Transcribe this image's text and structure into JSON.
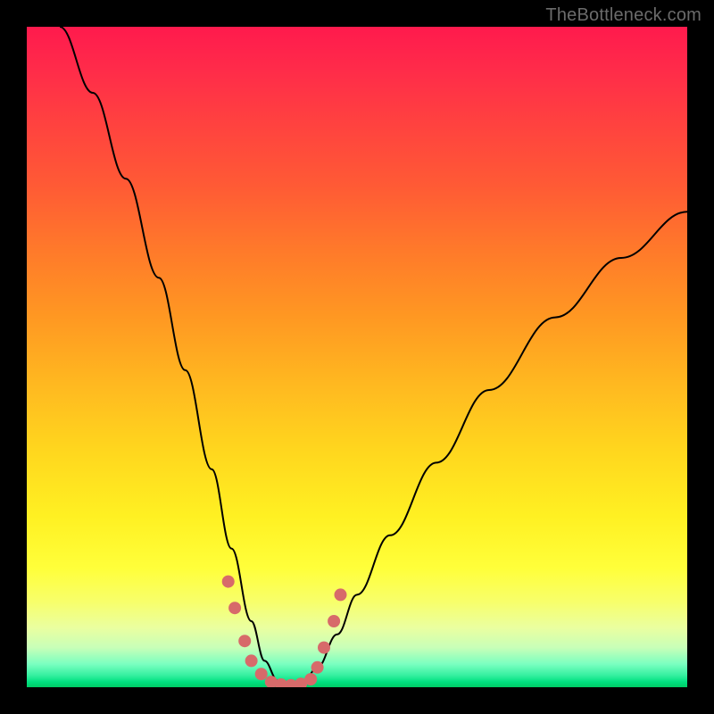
{
  "watermark": "TheBottleneck.com",
  "colors": {
    "page_bg": "#000000",
    "curve_stroke": "#000000",
    "marker_fill": "#d76a6a",
    "gradient_stops": [
      "#ff1a4d",
      "#ff2a4a",
      "#ff4040",
      "#ff5a35",
      "#ff7a2a",
      "#ff9822",
      "#ffb820",
      "#ffd61e",
      "#fff022",
      "#ffff3a",
      "#f8ff6a",
      "#eaffa0",
      "#c8ffb8",
      "#7affc0",
      "#35f0a0",
      "#00e080",
      "#00cc66"
    ]
  },
  "chart_data": {
    "type": "line",
    "title": "",
    "xlabel": "",
    "ylabel": "",
    "xlim": [
      0,
      100
    ],
    "ylim": [
      0,
      100
    ],
    "note": "Bottleneck-style V curve; y ≈ 0 at trough around x≈35–43; x/y in percent of plot area (0,0 = bottom-left).",
    "series": [
      {
        "name": "curve",
        "x": [
          5,
          10,
          15,
          20,
          24,
          28,
          31,
          34,
          36,
          38,
          40,
          42,
          44,
          47,
          50,
          55,
          62,
          70,
          80,
          90,
          100
        ],
        "y": [
          100,
          90,
          77,
          62,
          48,
          33,
          21,
          10,
          4,
          1,
          0,
          1,
          3,
          8,
          14,
          23,
          34,
          45,
          56,
          65,
          72
        ]
      }
    ],
    "markers": {
      "name": "trough-dots",
      "x": [
        30.5,
        31.5,
        33.0,
        34.0,
        35.5,
        37.0,
        38.5,
        40.0,
        41.5,
        43.0,
        44.0,
        45.0,
        46.5,
        47.5
      ],
      "y": [
        16,
        12,
        7,
        4,
        2,
        0.8,
        0.4,
        0.3,
        0.5,
        1.2,
        3,
        6,
        10,
        14
      ]
    }
  }
}
